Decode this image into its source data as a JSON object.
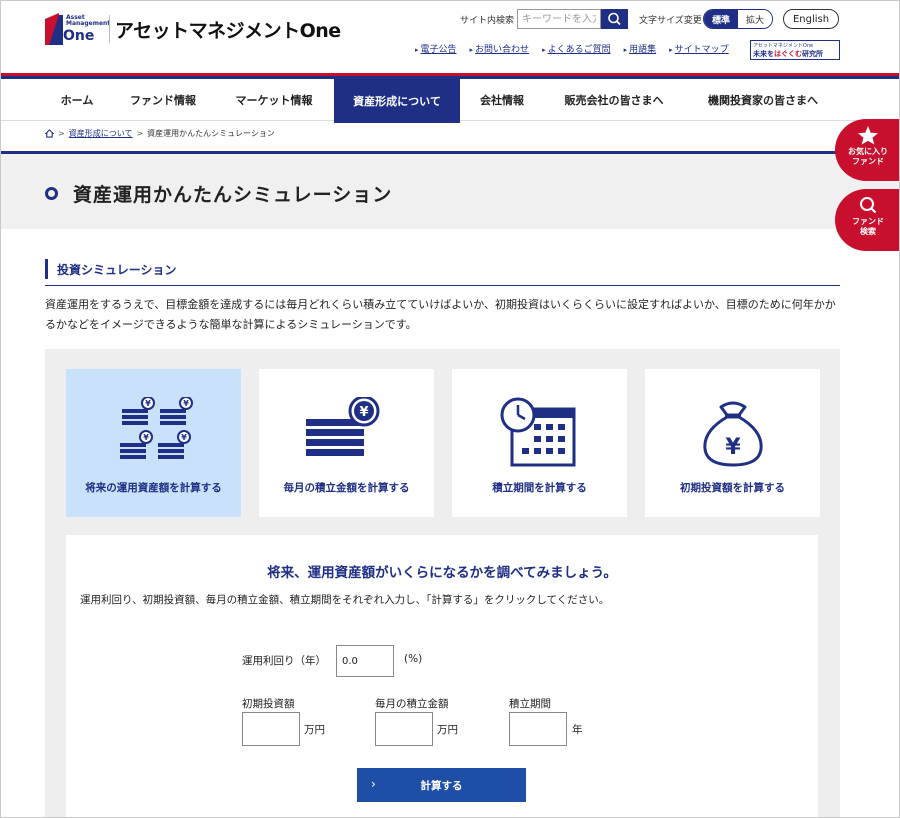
{
  "header": {
    "logo_small": "Asset Management",
    "logo_one": "One",
    "company_name": "アセットマネジメントOne",
    "search_label": "サイト内検索",
    "search_placeholder": "キーワードを入力",
    "font_size_label": "文字サイズ変更",
    "font_size_standard": "標準",
    "font_size_large": "拡大",
    "english": "English",
    "util_links": [
      "電子公告",
      "お問い合わせ",
      "よくあるご質問",
      "用語集",
      "サイトマップ"
    ],
    "lab_banner_line1": "アセットマネジメントOne",
    "lab_banner_line2a": "未来を",
    "lab_banner_line2b": "はぐくむ",
    "lab_banner_line2c": "研究所"
  },
  "nav": {
    "items": [
      "ホーム",
      "ファンド情報",
      "マーケット情報",
      "資産形成について",
      "会社情報",
      "販売会社の皆さまへ",
      "機関投資家の皆さまへ"
    ],
    "active_index": 3
  },
  "breadcrumb": {
    "home_icon": "home-icon",
    "link": "資産形成について",
    "current": "資産運用かんたんシミュレーション"
  },
  "page_title": "資産運用かんたんシミュレーション",
  "float": {
    "favorite": "お気に入りファンド",
    "favorite_line1": "お気に入り",
    "favorite_line2": "ファンド",
    "search_line1": "ファンド",
    "search_line2": "検索"
  },
  "section": {
    "title": "投資シミュレーション",
    "intro": "資産運用をするうえで、目標金額を達成するには毎月どれくらい積み立てていけばよいか、初期投資はいくらくらいに設定すればよいか、目標のために何年かかるかなどをイメージできるような簡単な計算によるシミュレーションです。"
  },
  "cards": [
    {
      "label": "将来の運用資産額を計算する",
      "icon": "coin-stacks-icon",
      "selected": true
    },
    {
      "label": "毎月の積立金額を計算する",
      "icon": "monthly-stack-icon",
      "selected": false
    },
    {
      "label": "積立期間を計算する",
      "icon": "calendar-clock-icon",
      "selected": false
    },
    {
      "label": "初期投資額を計算する",
      "icon": "money-bag-icon",
      "selected": false
    }
  ],
  "form": {
    "heading": "将来、運用資産額がいくらになるかを調べてみましょう。",
    "description": "運用利回り、初期投資額、毎月の積立金額、積立期間をそれぞれ入力し、「計算する」をクリックしてください。",
    "rate_label": "運用利回り（年）",
    "rate_value": "0.0",
    "rate_unit": "(%)",
    "initial_label": "初期投資額",
    "initial_value": "",
    "initial_unit": "万円",
    "monthly_label": "毎月の積立金額",
    "monthly_value": "",
    "monthly_unit": "万円",
    "period_label": "積立期間",
    "period_value": "",
    "period_unit": "年",
    "submit": "計算する"
  },
  "colors": {
    "navy": "#1f2f86",
    "red": "#c8102e",
    "selected_card": "#c9e1fa",
    "button": "#1f4ea6"
  }
}
